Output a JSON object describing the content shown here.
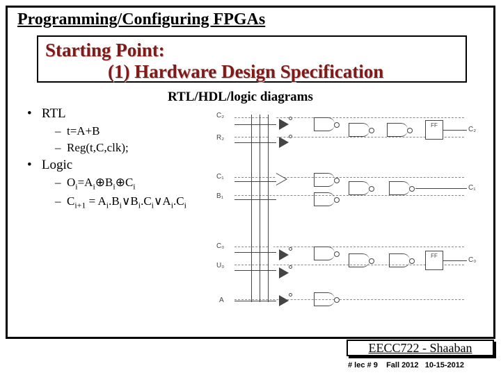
{
  "header": "Programming/Configuring FPGAs",
  "title": {
    "line1": "Starting Point:",
    "line2": "(1) Hardware Design Specification"
  },
  "subheading": "RTL/HDL/logic diagrams",
  "bullets": {
    "rtl": {
      "label": "RTL",
      "s1": "t=A+B",
      "s2": "Reg(t,C,clk);"
    },
    "logic": {
      "label": "Logic",
      "s1_html": "O<sub>i</sub>=A<sub>i</sub><span class='oplus'>⊕</span>B<sub>i</sub><span class='oplus'>⊕</span>C<sub>i</sub>",
      "s2_html": "C<sub>i+1</sub> = A<sub>i</sub>.B<sub>i</sub>∨B<sub>i</sub>.C<sub>i</sub>∨A<sub>i</sub>.C<sub>i</sub>"
    }
  },
  "diagram_labels": {
    "c2": "C₂",
    "r2": "R₂",
    "c1": "C₁",
    "b1": "B₁",
    "c0": "C₀",
    "u0": "U₀",
    "a": "A",
    "ff": "FF",
    "co_top": "C₂",
    "co_bot": "C₀",
    "c_mid": "C₁"
  },
  "footer": {
    "course": "EECC722 - Shaaban"
  },
  "subfooter": {
    "lec": "#  lec # 9",
    "term": "Fall 2012",
    "date": "10-15-2012"
  }
}
